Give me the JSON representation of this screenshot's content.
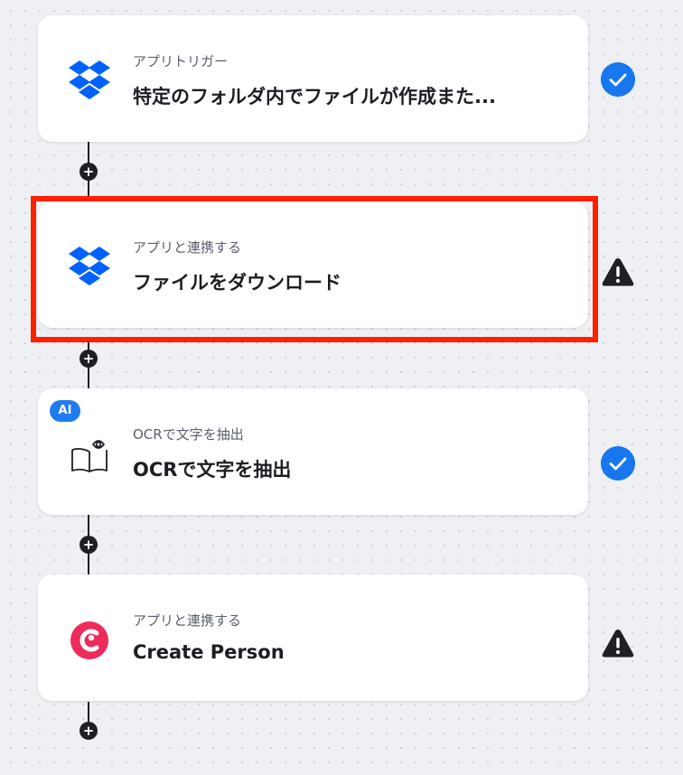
{
  "steps": [
    {
      "subtitle": "アプリトリガー",
      "title": "特定のフォルダ内でファイルが作成また...",
      "icon": "dropbox-icon",
      "status": "check-icon"
    },
    {
      "subtitle": "アプリと連携する",
      "title": "ファイルをダウンロード",
      "icon": "dropbox-icon",
      "status": "warning-icon"
    },
    {
      "subtitle": "OCRで文字を抽出",
      "title": "OCRで文字を抽出",
      "icon": "book-eye-icon",
      "badge": "AI",
      "status": "check-icon"
    },
    {
      "subtitle": "アプリと連携する",
      "title": "Create Person",
      "icon": "app-logo-icon",
      "status": "warning-icon"
    }
  ],
  "add_step_symbol": "+",
  "colors": {
    "dropbox": "#0061fe",
    "check_badge": "#1877ee",
    "highlight": "#ff2000",
    "ai_badge": "#1f7bf0",
    "app_logo": "#ee2b5b",
    "connector": "#1f1f24"
  }
}
